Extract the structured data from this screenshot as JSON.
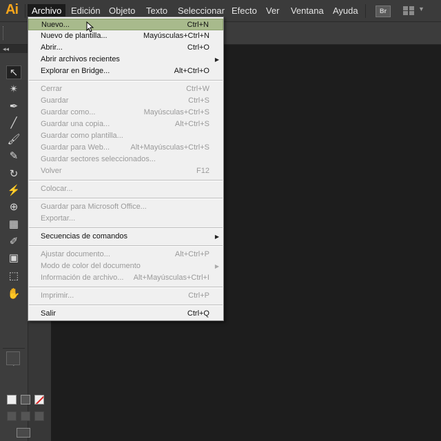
{
  "app": {
    "logo": "Ai"
  },
  "menubar": {
    "items": [
      "Archivo",
      "Edición",
      "Objeto",
      "Texto",
      "Seleccionar",
      "Efecto",
      "Ver",
      "Ventana",
      "Ayuda"
    ],
    "active": "Archivo",
    "bridge_button": "Br"
  },
  "tools_header": "◂◂",
  "menu": {
    "items": [
      {
        "label": "Nuevo...",
        "shortcut": "Ctrl+N",
        "disabled": false,
        "highlighted": true
      },
      {
        "label": "Nuevo de plantilla...",
        "shortcut": "Mayúsculas+Ctrl+N",
        "disabled": false
      },
      {
        "label": "Abrir...",
        "shortcut": "Ctrl+O",
        "disabled": false
      },
      {
        "label": "Abrir archivos recientes",
        "shortcut": "",
        "disabled": false,
        "submenu": true
      },
      {
        "label": "Explorar en Bridge...",
        "shortcut": "Alt+Ctrl+O",
        "disabled": false
      },
      {
        "label": "Cerrar",
        "shortcut": "Ctrl+W",
        "disabled": true
      },
      {
        "label": "Guardar",
        "shortcut": "Ctrl+S",
        "disabled": true
      },
      {
        "label": "Guardar como...",
        "shortcut": "Mayúsculas+Ctrl+S",
        "disabled": true
      },
      {
        "label": "Guardar una copia...",
        "shortcut": "Alt+Ctrl+S",
        "disabled": true
      },
      {
        "label": "Guardar como plantilla...",
        "shortcut": "",
        "disabled": true
      },
      {
        "label": "Guardar para Web...",
        "shortcut": "Alt+Mayúsculas+Ctrl+S",
        "disabled": true
      },
      {
        "label": "Guardar sectores seleccionados...",
        "shortcut": "",
        "disabled": true
      },
      {
        "label": "Volver",
        "shortcut": "F12",
        "disabled": true
      },
      {
        "label": "Colocar...",
        "shortcut": "",
        "disabled": true
      },
      {
        "label": "Guardar para Microsoft Office...",
        "shortcut": "",
        "disabled": true
      },
      {
        "label": "Exportar...",
        "shortcut": "",
        "disabled": true
      },
      {
        "label": "Secuencias de comandos",
        "shortcut": "",
        "disabled": false,
        "submenu": true
      },
      {
        "label": "Ajustar documento...",
        "shortcut": "Alt+Ctrl+P",
        "disabled": true
      },
      {
        "label": "Modo de color del documento",
        "shortcut": "",
        "disabled": true,
        "submenu": true
      },
      {
        "label": "Información de archivo...",
        "shortcut": "Alt+Mayúsculas+Ctrl+I",
        "disabled": true
      },
      {
        "label": "Imprimir...",
        "shortcut": "Ctrl+P",
        "disabled": true
      },
      {
        "label": "Salir",
        "shortcut": "Ctrl+Q",
        "disabled": false
      }
    ]
  },
  "tools": [
    {
      "name": "selection-tool-icon",
      "glyph": "↖",
      "selected": true
    },
    {
      "name": "magic-wand-tool-icon",
      "glyph": "✴"
    },
    {
      "name": "pen-tool-icon",
      "glyph": "✒"
    },
    {
      "name": "line-tool-icon",
      "glyph": "╱"
    },
    {
      "name": "paintbrush-tool-icon",
      "glyph": "🖌"
    },
    {
      "name": "blob-brush-tool-icon",
      "glyph": "✎"
    },
    {
      "name": "rotate-tool-icon",
      "glyph": "↻"
    },
    {
      "name": "width-tool-icon",
      "glyph": "⚡"
    },
    {
      "name": "shape-builder-tool-icon",
      "glyph": "⊕"
    },
    {
      "name": "perspective-grid-tool-icon",
      "glyph": "▦"
    },
    {
      "name": "eyedropper-tool-icon",
      "glyph": "✐"
    },
    {
      "name": "symbol-sprayer-tool-icon",
      "glyph": "▣"
    },
    {
      "name": "artboard-tool-icon",
      "glyph": "⬚"
    },
    {
      "name": "hand-tool-icon",
      "glyph": "✋"
    }
  ],
  "swatch_colors": {
    "fill": "#ffffff",
    "stroke": "#000000"
  }
}
